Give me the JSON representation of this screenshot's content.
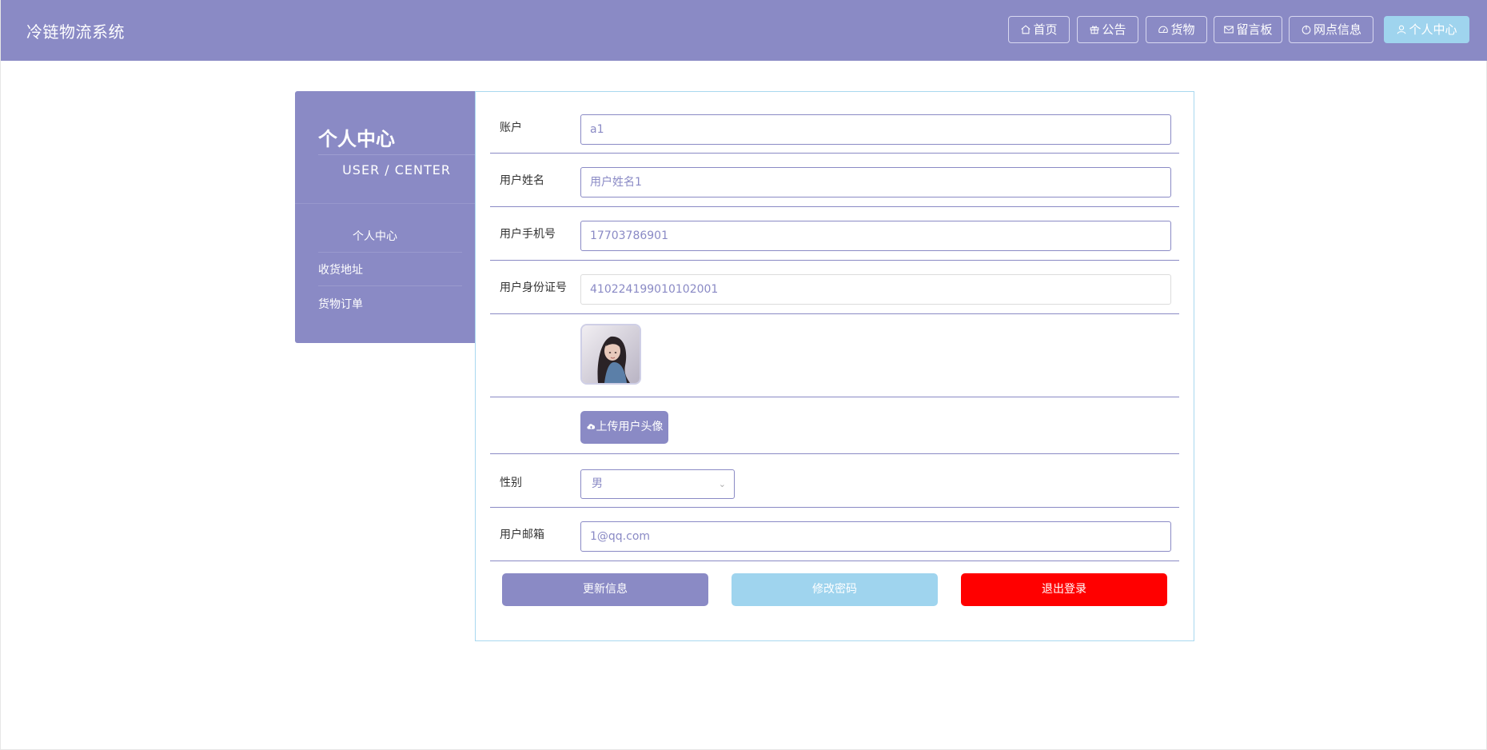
{
  "header": {
    "brand": "冷链物流系统",
    "nav": [
      {
        "label": "首页",
        "icon": "home-icon"
      },
      {
        "label": "公告",
        "icon": "gift-icon"
      },
      {
        "label": "货物",
        "icon": "dashboard-icon"
      },
      {
        "label": "留言板",
        "icon": "mail-icon"
      },
      {
        "label": "网点信息",
        "icon": "power-icon"
      },
      {
        "label": "个人中心",
        "icon": "user-icon",
        "active": true
      }
    ]
  },
  "sidebar": {
    "title": "个人中心",
    "subtitle": "USER / CENTER",
    "items": [
      "个人中心",
      "收货地址",
      "货物订单"
    ]
  },
  "form": {
    "account": {
      "label": "账户",
      "value": "a1"
    },
    "name": {
      "label": "用户姓名",
      "value": "用户姓名1"
    },
    "phone": {
      "label": "用户手机号",
      "value": "17703786901"
    },
    "id_card": {
      "label": "用户身份证号",
      "value": "410224199010102001"
    },
    "upload_label": "上传用户头像",
    "gender": {
      "label": "性别",
      "value": "男"
    },
    "email": {
      "label": "用户邮箱",
      "value": "1@qq.com"
    }
  },
  "actions": {
    "update": "更新信息",
    "change_password": "修改密码",
    "logout": "退出登录"
  },
  "colors": {
    "primary": "#8a8ac5",
    "secondary": "#9fd4ee",
    "danger": "#ff0000"
  }
}
